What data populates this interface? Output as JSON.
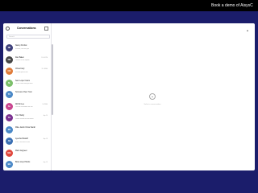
{
  "topbar": {
    "demo_link": "Book a demo of AisysC"
  },
  "sidebar": {
    "title": "Conversations",
    "search_placeholder": "Search",
    "items": [
      {
        "name": "Nancy Perfusi",
        "snippet": "Hi there, how are you",
        "time": "",
        "initials": "NP",
        "color": "#3d3f7a"
      },
      {
        "name": "Dan Baker",
        "snippet": "Thanks for the update",
        "time": "12:04 PM",
        "initials": "DB",
        "color": "#454545"
      },
      {
        "name": "Olivia Kelly",
        "snippet": "Sounds good to me",
        "time": "11:18 AM",
        "initials": "OK",
        "color": "#e07b39"
      },
      {
        "name": "Sam Lopez Gram",
        "snippet": "Let me check and get back",
        "time": "",
        "initials": "SL",
        "color": "#7bbf6a"
      },
      {
        "name": "Terrence Chen Yoon",
        "snippet": "",
        "time": "",
        "initials": "TC",
        "color": "#4a88c7"
      },
      {
        "name": "AM Ali Lee",
        "snippet": "Can we reschedule the call",
        "time": "9:42 AM",
        "initials": "AL",
        "color": "#c9458f"
      },
      {
        "name": "Tom Hardy",
        "snippet": "Please review the document",
        "time": "Apr 20",
        "initials": "TH",
        "color": "#7a2f8f"
      },
      {
        "name": "Mike Jacob Chow Sarah",
        "snippet": "",
        "time": "",
        "initials": "MJ",
        "color": "#4a88c7"
      },
      {
        "name": "Ayesha Sharaff",
        "snippet": "Sure, I will send it over",
        "time": "Apr 18",
        "initials": "AS",
        "color": "#3b6fb3"
      },
      {
        "name": "Mark Gogreen",
        "snippet": "",
        "time": "",
        "initials": "MG",
        "color": "#e0463c"
      },
      {
        "name": "Brian Lloyd Harris",
        "snippet": "",
        "time": "Apr 16",
        "initials": "BH",
        "color": "#4a88c7"
      }
    ]
  },
  "main": {
    "empty_text": "Select a conversation"
  }
}
